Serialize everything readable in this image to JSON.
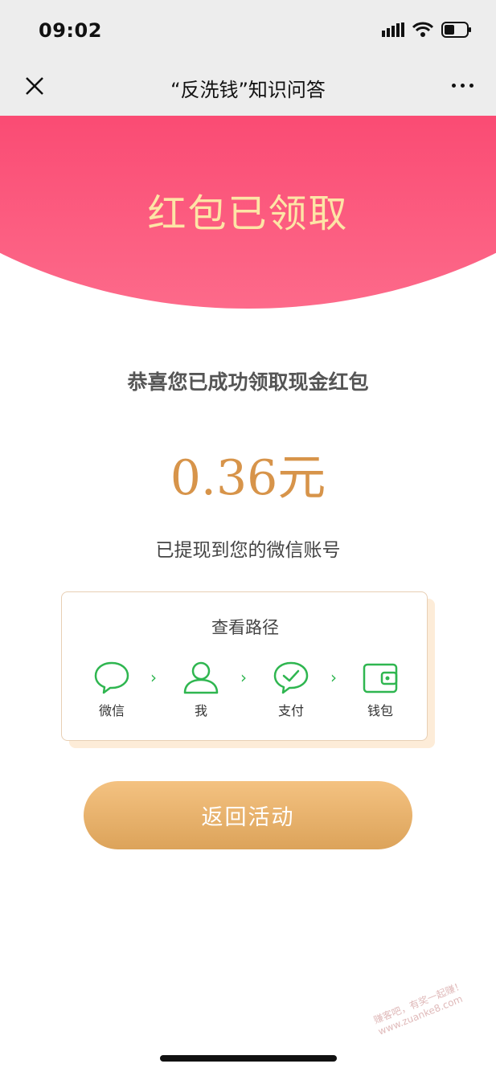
{
  "status_bar": {
    "time": "09:02"
  },
  "nav": {
    "title": "“反洗钱”知识问答"
  },
  "banner": {
    "title": "红包已领取"
  },
  "result": {
    "congrats": "恭喜您已成功领取现金红包",
    "amount": "0.36元",
    "note": "已提现到您的微信账号"
  },
  "path_card": {
    "title": "查看路径",
    "steps": [
      {
        "label": "微信",
        "icon": "chat-icon"
      },
      {
        "label": "我",
        "icon": "person-icon"
      },
      {
        "label": "支付",
        "icon": "check-chat-icon"
      },
      {
        "label": "钱包",
        "icon": "wallet-icon"
      }
    ],
    "separator": "›"
  },
  "return_button": {
    "label": "返回活动"
  },
  "watermark": {
    "text": "赚客吧，有奖一起赚！ www.zuanke8.com"
  },
  "colors": {
    "banner": "#f9416c",
    "banner_title": "#fde5a6",
    "amount": "#d7944a",
    "icon_green": "#2fb650",
    "button_start": "#f4c281",
    "button_end": "#dca35a"
  }
}
